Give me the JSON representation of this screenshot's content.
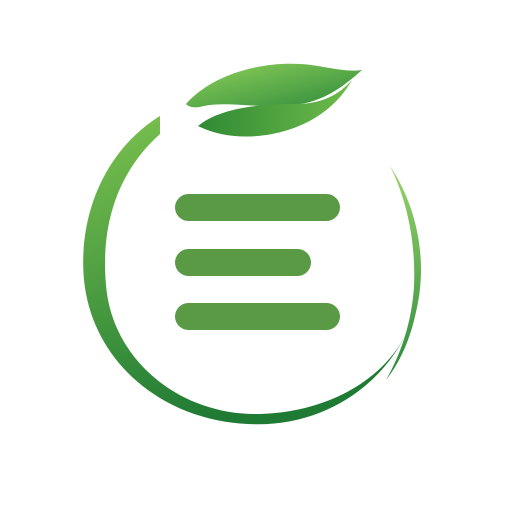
{
  "logo": {
    "description_icon": "leaf-ring-menu-icon",
    "colors": {
      "ring_light": "#7cc24f",
      "ring_dark": "#1f7a34",
      "leaf_light": "#8fd05a",
      "leaf_dark": "#2d8a3a",
      "bars": "#5a9a44",
      "background": "#ffffff"
    }
  }
}
